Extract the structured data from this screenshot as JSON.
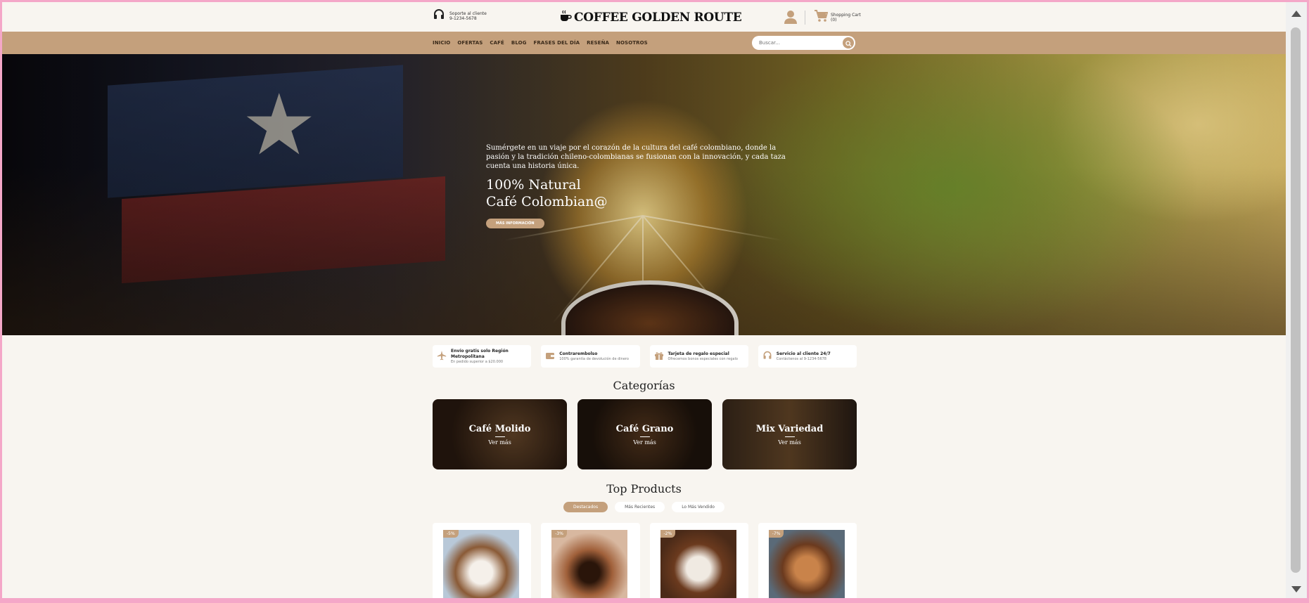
{
  "header": {
    "support_line1": "Soporte al cliente",
    "support_line2": "9-1234-5678",
    "logo_text": "COFFEE GOLDEN ROUTE",
    "cart_label": "Shopping Cart",
    "cart_count": "(0)"
  },
  "nav": {
    "items": [
      "INICIO",
      "OFERTAS",
      "CAFÉ",
      "BLOG",
      "FRASES DEL DÍA",
      "RESEÑA",
      "NOSOTROS"
    ],
    "search_placeholder": "Buscar..."
  },
  "hero": {
    "description": "Sumérgete en un viaje por el corazón de la cultura del café colombiano, donde la pasión y la tradición chileno-colombianas se fusionan con la innovación, y cada taza cuenta una historia única.",
    "title_line1": "100% Natural",
    "title_line2": "Café Colombian@",
    "button": "MÁS INFORMACIÓN"
  },
  "features": [
    {
      "title": "Envío gratis solo Región Metropolitana",
      "subtitle": "En pedido superior a $20.000",
      "icon": "airplane-icon"
    },
    {
      "title": "Contrarembolso",
      "subtitle": "100% garantía de devolución de dinero",
      "icon": "wallet-icon"
    },
    {
      "title": "Tarjeta de regalo especial",
      "subtitle": "Ofrecemos bonos especiales con regalo",
      "icon": "gift-icon"
    },
    {
      "title": "Servicio al cliente 24/7",
      "subtitle": "Contáctenos al 9-1234-5678",
      "icon": "headset-icon"
    }
  ],
  "categories_title": "Categorías",
  "categories": [
    {
      "title": "Café Molido",
      "link": "Ver más"
    },
    {
      "title": "Café Grano",
      "link": "Ver más"
    },
    {
      "title": "Mix Variedad",
      "link": "Ver más"
    }
  ],
  "top_products_title": "Top Products",
  "tabs": [
    "Destacados",
    "Más Recientes",
    "Lo Más Vendido"
  ],
  "products": [
    {
      "discount": "-5%"
    },
    {
      "discount": "-3%"
    },
    {
      "discount": "-2%"
    },
    {
      "discount": "-7%"
    }
  ],
  "colors": {
    "accent": "#c4a07c",
    "background": "#f8f5f0",
    "frame": "#f4a7c8"
  }
}
